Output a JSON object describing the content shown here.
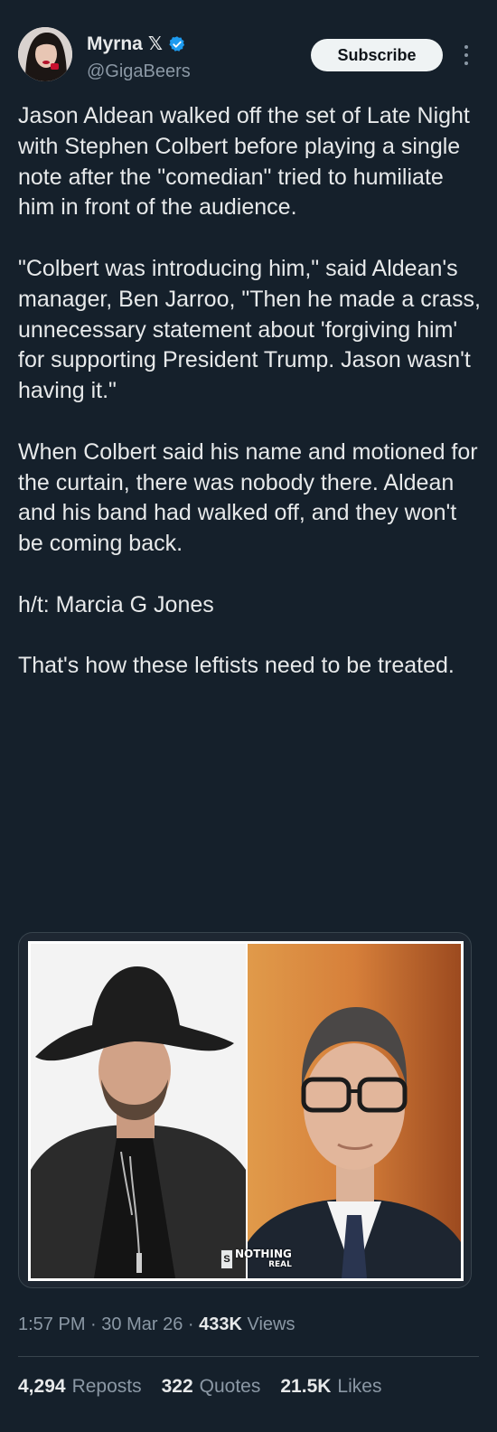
{
  "author": {
    "display_name": "Myrna",
    "x_badge": "𝕏",
    "handle": "@GigaBeers",
    "verified_color": "#1d9bf0"
  },
  "actions": {
    "subscribe_label": "Subscribe",
    "more_icon": "more-vertical-icon"
  },
  "tweet": {
    "paragraphs": [
      "Jason Aldean walked off the set of Late Night with Stephen Colbert before playing a single note after the \"comedian\" tried to humiliate him in front of the audience.",
      "\"Colbert was introducing him,\" said Aldean's manager, Ben Jarroo, \"Then he made a crass, unnecessary statement about 'forgiving him' for supporting President Trump. Jason wasn't having it.\"",
      "When Colbert said his name and motioned for the curtain, there was nobody there. Aldean and his band had walked off, and they won't be coming back.",
      "h/t: Marcia G Jones",
      "That's how these leftists need to be treated."
    ]
  },
  "media": {
    "watermark_text": "NOTHING",
    "watermark_sub": "REAL",
    "watermark_letter": "S"
  },
  "meta": {
    "time": "1:57 PM",
    "sep1": " · ",
    "date": "30 Mar 26",
    "sep2": " · ",
    "views_count": "433K",
    "views_label": " Views"
  },
  "stats": {
    "reposts_count": "4,294",
    "reposts_label": "Reposts",
    "quotes_count": "322",
    "quotes_label": "Quotes",
    "likes_count": "21.5K",
    "likes_label": "Likes"
  }
}
